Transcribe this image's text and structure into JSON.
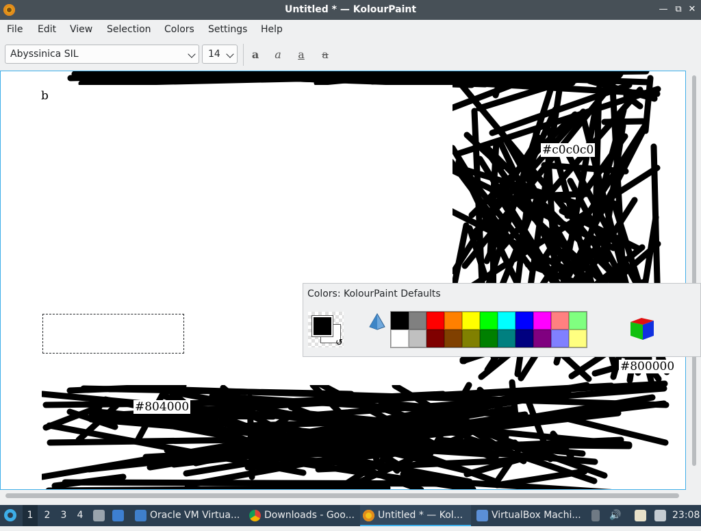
{
  "window": {
    "title": "Untitled * — KolourPaint"
  },
  "menu": [
    "File",
    "Edit",
    "View",
    "Selection",
    "Colors",
    "Settings",
    "Help"
  ],
  "toolbar": {
    "font": "Abyssinica SIL",
    "size": "14",
    "format_glyphs": [
      "a",
      "a",
      "a",
      "a"
    ]
  },
  "canvas": {
    "texts": [
      "b",
      "#c0c0c0",
      "#800000",
      "#804000"
    ]
  },
  "colors_panel": {
    "title": "Colors: KolourPaint Defaults",
    "foreground": "#000000",
    "background": "#ffffff",
    "palette": [
      "#000000",
      "#808080",
      "#ff0000",
      "#ff8000",
      "#ffff00",
      "#00ff00",
      "#00ffff",
      "#0000ff",
      "#ff00ff",
      "#ff8080",
      "#80ff80",
      "#ffffff",
      "#c0c0c0",
      "#800000",
      "#804000",
      "#808000",
      "#008000",
      "#008080",
      "#000080",
      "#800080",
      "#8080ff",
      "#ffff80"
    ]
  },
  "taskbar": {
    "desktops": [
      "1",
      "2",
      "3",
      "4"
    ],
    "tasks": [
      {
        "label": "Oracle VM Virtua...",
        "icon": "virtualbox-icon"
      },
      {
        "label": "Downloads - Goo...",
        "icon": "chrome-icon"
      },
      {
        "label": "Untitled * — Kol...",
        "icon": "kolourpaint-icon"
      },
      {
        "label": "VirtualBox Machi...",
        "icon": "vm-icon"
      }
    ],
    "clock": "23:08"
  }
}
